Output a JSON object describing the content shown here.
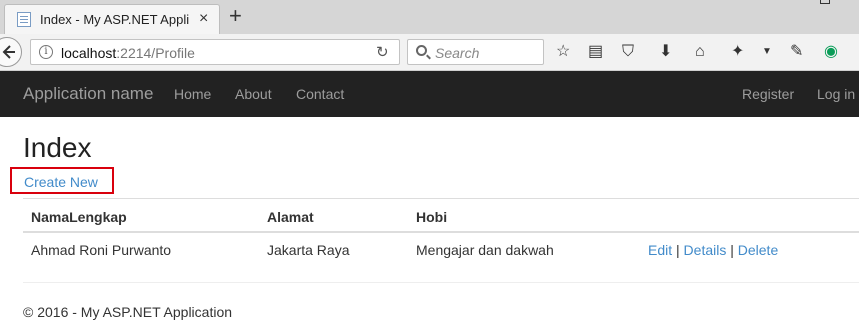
{
  "browser": {
    "tab_title": "Index - My ASP.NET Appli…",
    "tab_close": "×",
    "new_tab": "+",
    "url_host": "localhost",
    "url_rest": ":2214/Profile",
    "search_placeholder": "Search"
  },
  "site": {
    "brand": "Application name",
    "nav_left": [
      "Home",
      "About",
      "Contact"
    ],
    "nav_right": [
      "Register",
      "Log in"
    ]
  },
  "page": {
    "title": "Index",
    "create_link": "Create New",
    "table": {
      "headers": [
        "NamaLengkap",
        "Alamat",
        "Hobi"
      ],
      "rows": [
        {
          "cells": [
            "Ahmad Roni Purwanto",
            "Jakarta Raya",
            "Mengajar dan dakwah"
          ],
          "actions": [
            "Edit",
            "Details",
            "Delete"
          ],
          "separator": "|"
        }
      ]
    },
    "footer": "© 2016 - My ASP.NET Application"
  },
  "colors": {
    "navbar_bg": "#222222",
    "link": "#428bca",
    "highlight_border": "#d9000d"
  }
}
